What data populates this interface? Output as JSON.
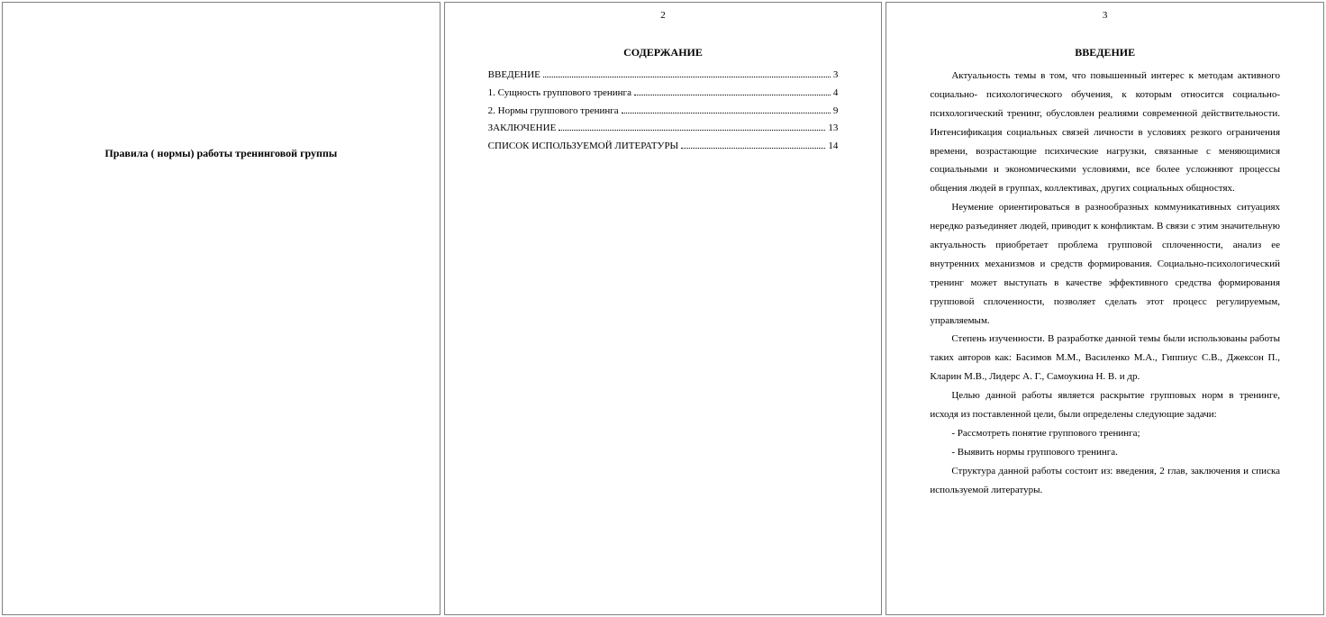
{
  "page1": {
    "title_line": "Правила ( нормы) работы тренинговой группы"
  },
  "page2": {
    "page_number": "2",
    "heading": "СОДЕРЖАНИЕ",
    "toc": [
      {
        "label": "ВВЕДЕНИЕ",
        "page": "3"
      },
      {
        "label": "1. Сущность группового тренинга",
        "page": "4"
      },
      {
        "label": "2. Нормы группового тренинга",
        "page": "9"
      },
      {
        "label": "ЗАКЛЮЧЕНИЕ",
        "page": "13"
      },
      {
        "label": "СПИСОК ИСПОЛЬЗУЕМОЙ ЛИТЕРАТУРЫ",
        "page": "14"
      }
    ]
  },
  "page3": {
    "page_number": "3",
    "heading": "ВВЕДЕНИЕ",
    "paragraphs": [
      "Актуальность темы в том, что повышенный интерес к методам активного социально- психологического обучения, к которым относится социально-психологический тренинг, обусловлен реалиями современной действительности. Интенсификация социальных связей личности в условиях резкого ограничения времени, возрастающие психические нагрузки, связанные с меняющимися социальными и экономическими условиями, все более усложняют процессы общения людей в группах, коллективах, других социальных общностях.",
      "Неумение ориентироваться в разнообразных коммуникативных ситуациях нередко разъединяет людей, приводит к конфликтам. В связи с этим значительную актуальность приобретает проблема групповой сплоченности, анализ ее внутренних механизмов и средств формирования. Социально-психологический тренинг может выступать в качестве эффективного средства формирования групповой сплоченности, позволяет сделать этот процесс регулируемым, управляемым.",
      "Степень изученности. В разработке данной темы были использованы работы таких авторов как: Басимов М.М., Василенко М.А., Гиппиус С.В., Джексон П., Кларин М.В., Лидерс А. Г., Самоукина Н. В. и др.",
      "Целью данной работы является раскрытие групповых норм в тренинге, исходя из поставленной цели, были определены следующие задачи:",
      "- Рассмотреть понятие группового тренинга;",
      "- Выявить нормы группового тренинга.",
      "Структура данной работы состоит из: введения, 2 глав, заключения и списка используемой литературы."
    ]
  }
}
